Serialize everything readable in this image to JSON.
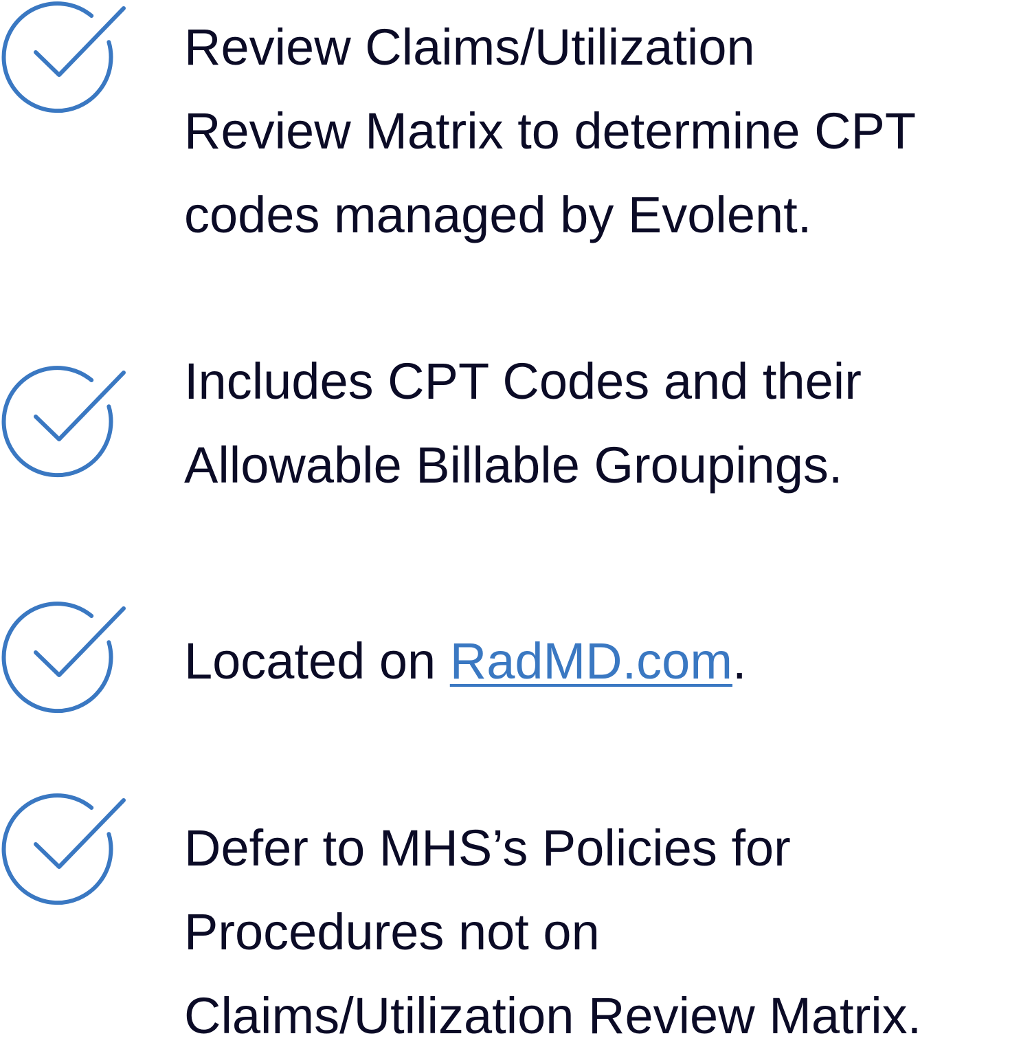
{
  "accent_color": "#3a78c2",
  "text_color": "#0b0b26",
  "items": [
    {
      "icon": "check-circle-icon",
      "lines": [
        "Review Claims/Utilization",
        "Review Matrix to determine CPT",
        "codes managed by Evolent."
      ]
    },
    {
      "icon": "check-circle-icon",
      "lines": [
        "Includes CPT Codes and their",
        "Allowable Billable Groupings."
      ]
    },
    {
      "icon": "check-circle-icon",
      "prefix": "Located on ",
      "link_text": "RadMD.com",
      "suffix": "."
    },
    {
      "icon": "check-circle-icon",
      "lines": [
        "Defer to MHS’s Policies for",
        "Procedures not on",
        "Claims/Utilization Review Matrix."
      ]
    }
  ]
}
